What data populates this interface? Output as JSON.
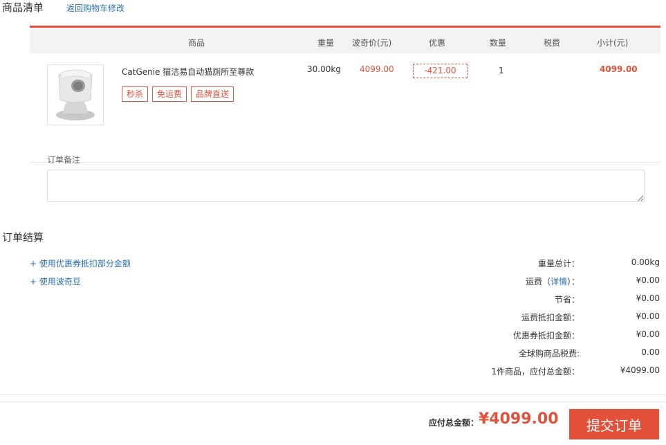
{
  "header": {
    "title": "商品清单",
    "back_link": "返回购物车修改"
  },
  "table": {
    "columns": [
      "商品",
      "重量",
      "波奇价(元)",
      "优惠",
      "数量",
      "税费",
      "小计(元)"
    ],
    "rows": [
      {
        "name": "CatGenie 猫洁易自动猫厕所至尊款",
        "tags": [
          "秒杀",
          "免运费",
          "品牌直送"
        ],
        "weight": "30.00kg",
        "price": "4099.00",
        "discount": "-421.00",
        "qty": "1",
        "tax": "",
        "subtotal": "4099.00"
      }
    ]
  },
  "remark": {
    "label": "订单备注",
    "value": ""
  },
  "settlement": {
    "title": "订单结算",
    "links": [
      "+ 使用优惠券抵扣部分金额",
      "+ 使用波奇豆"
    ],
    "summary": [
      {
        "label": "重量总计：",
        "value": "0.00kg"
      },
      {
        "label_prefix": "运费（",
        "label_link": "详情",
        "label_suffix": "）：",
        "value": "¥0.00"
      },
      {
        "label": "节省：",
        "value": "¥0.00"
      },
      {
        "label": "运费抵扣金额：",
        "value": "¥0.00"
      },
      {
        "label": "优惠券抵扣金额：",
        "value": "¥0.00"
      },
      {
        "label": "全球购商品税费:",
        "value": "0.00"
      },
      {
        "label": "1件商品，应付总金额：",
        "value": "¥4099.00"
      }
    ]
  },
  "footer": {
    "total_label": "应付总金额：",
    "total_value": "¥4099.00",
    "submit_label": "提交订单"
  },
  "colors": {
    "accent": "#e4513a",
    "link": "#2a6fb5"
  }
}
